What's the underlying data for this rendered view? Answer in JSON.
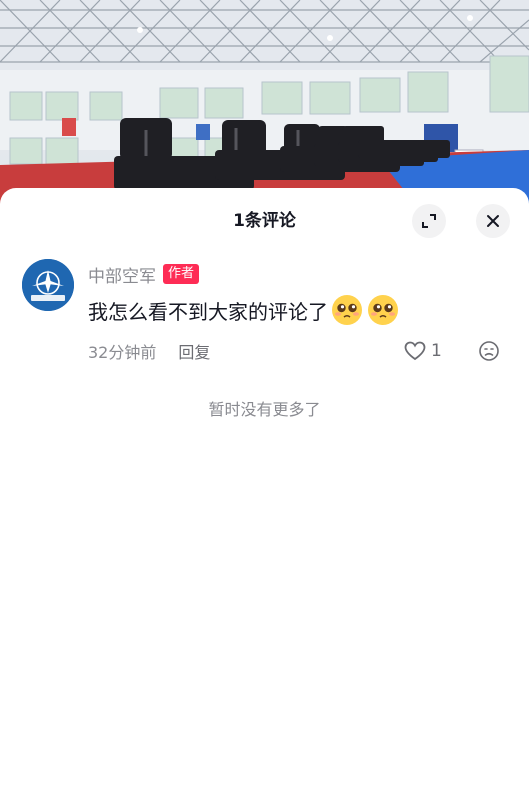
{
  "panel": {
    "title": "1条评论",
    "expand_icon": "expand-icon",
    "close_icon": "close-icon"
  },
  "comment": {
    "author": "中部空军",
    "author_badge": "作者",
    "text": "我怎么看不到大家的评论了",
    "emojis": [
      "pleading-face-emoji",
      "pleading-face-emoji"
    ],
    "time_ago": "32分钟前",
    "reply_label": "回复",
    "like_icon": "heart-outline-icon",
    "like_count": "1",
    "dislike_icon": "dislike-face-icon",
    "avatar_logo_text": "中部空军"
  },
  "footer": {
    "no_more_text": "暂时没有更多了"
  },
  "colors": {
    "badge": "#fe2c55",
    "avatar_bg": "#1f67b1",
    "text_primary": "#161823",
    "text_secondary": "#8a8b91"
  }
}
